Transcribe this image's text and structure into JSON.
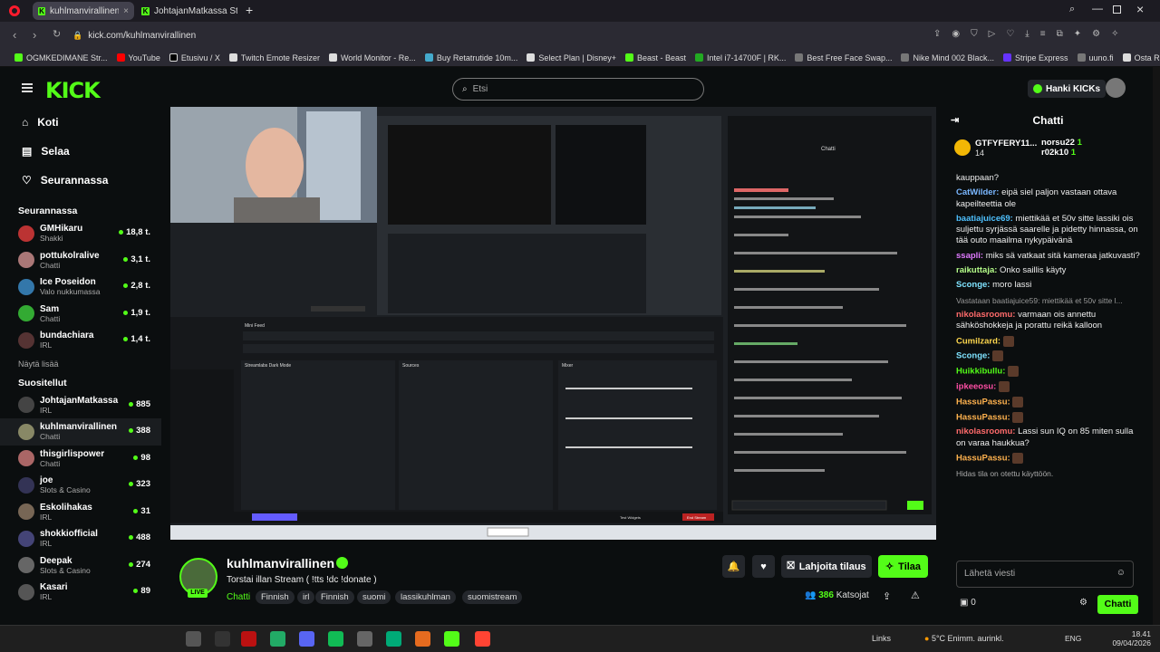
{
  "browser": {
    "tabs": [
      {
        "label": "kuhlmanvirallinen Stream"
      },
      {
        "label": "JohtajanMatkassa Stream"
      }
    ],
    "url": "kick.com/kuhlmanvirallinen",
    "bookmarks": [
      "OGMKEDIMANE Str...",
      "YouTube",
      "Etusivu / X",
      "Twitch Emote Resizer",
      "World Monitor - Re...",
      "Buy Retatrutide 10m...",
      "Select Plan | Disney+",
      "Beast - Beast",
      "Intel i7-14700F | RK...",
      "Best Free Face Swap...",
      "Nike Mind 002 Black...",
      "Stripe Express",
      "uuno.fi",
      "Osta Retatrutides | T..."
    ]
  },
  "header": {
    "search_placeholder": "Etsi",
    "get_kicks": "Hanki KICKs"
  },
  "sidebar": {
    "nav": [
      {
        "label": "Koti"
      },
      {
        "label": "Selaa"
      },
      {
        "label": "Seurannassa"
      }
    ],
    "following_title": "Seurannassa",
    "following": [
      {
        "name": "GMHikaru",
        "game": "Shakki",
        "viewers": "18,8 t.",
        "color": "#b33"
      },
      {
        "name": "pottukolralive",
        "game": "Chatti",
        "viewers": "3,1 t.",
        "color": "#a77"
      },
      {
        "name": "Ice Poseidon",
        "game": "Valo nukkumassa",
        "viewers": "2,8 t.",
        "color": "#37a"
      },
      {
        "name": "Sam",
        "game": "Chatti",
        "viewers": "1,9 t.",
        "color": "#3a3"
      },
      {
        "name": "bundachiara",
        "game": "IRL",
        "viewers": "1,4 t.",
        "color": "#533"
      }
    ],
    "show_more": "Näytä lisää",
    "recommended_title": "Suositellut",
    "recommended": [
      {
        "name": "JohtajanMatkassa",
        "game": "IRL",
        "viewers": "885",
        "color": "#444"
      },
      {
        "name": "kuhlmanvirallinen",
        "game": "Chatti",
        "viewers": "388",
        "color": "#886"
      },
      {
        "name": "thisgirlispower",
        "game": "Chatti",
        "viewers": "98",
        "color": "#a66"
      },
      {
        "name": "joe",
        "game": "Slots & Casino",
        "viewers": "323",
        "color": "#335"
      },
      {
        "name": "Eskolihakas",
        "game": "IRL",
        "viewers": "31",
        "color": "#765"
      },
      {
        "name": "shokkiofficial",
        "game": "IRL",
        "viewers": "488",
        "color": "#447"
      },
      {
        "name": "Deepak",
        "game": "Slots & Casino",
        "viewers": "274",
        "color": "#666"
      },
      {
        "name": "Kasari",
        "game": "IRL",
        "viewers": "89",
        "color": "#555"
      }
    ]
  },
  "video": {
    "chat_title": "Chatti",
    "mini_feed": "Mini Feed",
    "sources": "Sources",
    "mixer": "Mixer",
    "scene": "Streamlabs Dark Mode",
    "end_stream": "End Stream",
    "test_widgets": "Test Widgets"
  },
  "stream": {
    "channel": "kuhlmanvirallinen",
    "live_badge": "LIVE",
    "title": "Torstai illan Stream ( !tts !dc !donate )",
    "category": "Chatti",
    "tags": [
      "Finnish",
      "irl",
      "Finnish",
      "suomi",
      "lassikuhlman",
      "suomistream"
    ],
    "viewers": "386",
    "viewers_label": "Katsojat",
    "gift_sub": "Lahjoita tilaus",
    "subscribe": "Tilaa"
  },
  "chat": {
    "title": "Chatti",
    "top_gifters": [
      {
        "name": "GTFYFERY11...",
        "count": "14"
      },
      {
        "name": "norsu22",
        "count": "1"
      },
      {
        "name": "r02k10",
        "count": "1"
      }
    ],
    "messages": [
      {
        "user": "",
        "color": "#eee",
        "text": "kauppaan?"
      },
      {
        "user": "CatWilder:",
        "color": "#7ab7ff",
        "text": "eipä siel paljon vastaan ottava kapeilteettia ole"
      },
      {
        "user": "baatiajuice69:",
        "color": "#4ec1ff",
        "text": "miettikää et 50v sitte lassiki ois suljettu syrjässä saarelle ja pidetty hinnassa, on tää outo maailma nykypäivänä"
      },
      {
        "user": "ssapli:",
        "color": "#e07aff",
        "text": "miks sä vatkaat sitä kameraa jatkuvasti?"
      },
      {
        "user": "raikuttaja:",
        "color": "#b6ff8a",
        "text": "Onko saillis käyty"
      },
      {
        "user": "Sconge:",
        "color": "#7fe3ff",
        "text": "moro lassi"
      },
      {
        "user": "nikolasroomu:",
        "color": "#ff6b6b",
        "text": "varmaan ois annettu sähköshokkeja ja porattu reikä kalloon"
      },
      {
        "user": "Cumilzard:",
        "color": "#ffd84e",
        "text": ""
      },
      {
        "user": "Sconge:",
        "color": "#7fe3ff",
        "text": ""
      },
      {
        "user": "Huikkibullu:",
        "color": "#53fc18",
        "text": ""
      },
      {
        "user": "ipkeeosu:",
        "color": "#ff4ea5",
        "text": ""
      },
      {
        "user": "HassuPassu:",
        "color": "#ffb24e",
        "text": ""
      },
      {
        "user": "HassuPassu:",
        "color": "#ffb24e",
        "text": ""
      },
      {
        "user": "nikolasroomu:",
        "color": "#ff6b6b",
        "text": "Lassi sun IQ on 85 miten sulla on varaa haukkua?"
      },
      {
        "user": "HassuPassu:",
        "color": "#ffb24e",
        "text": ""
      }
    ],
    "slow_mode": "Hidas tila on otettu käyttöön.",
    "reply_preview": "Vastataan baatiajuice59: miettikää et 50v sitte l...",
    "input_placeholder": "Lähetä viesti",
    "kicks": "0",
    "send": "Chatti"
  },
  "taskbar": {
    "links": "Links",
    "weather": "5°C Enimm. aurinkl.",
    "lang": "ENG",
    "time": "18.41",
    "date": "09/04/2026"
  },
  "colors": {
    "accent": "#53fc18",
    "bg": "#0b0e0f"
  }
}
